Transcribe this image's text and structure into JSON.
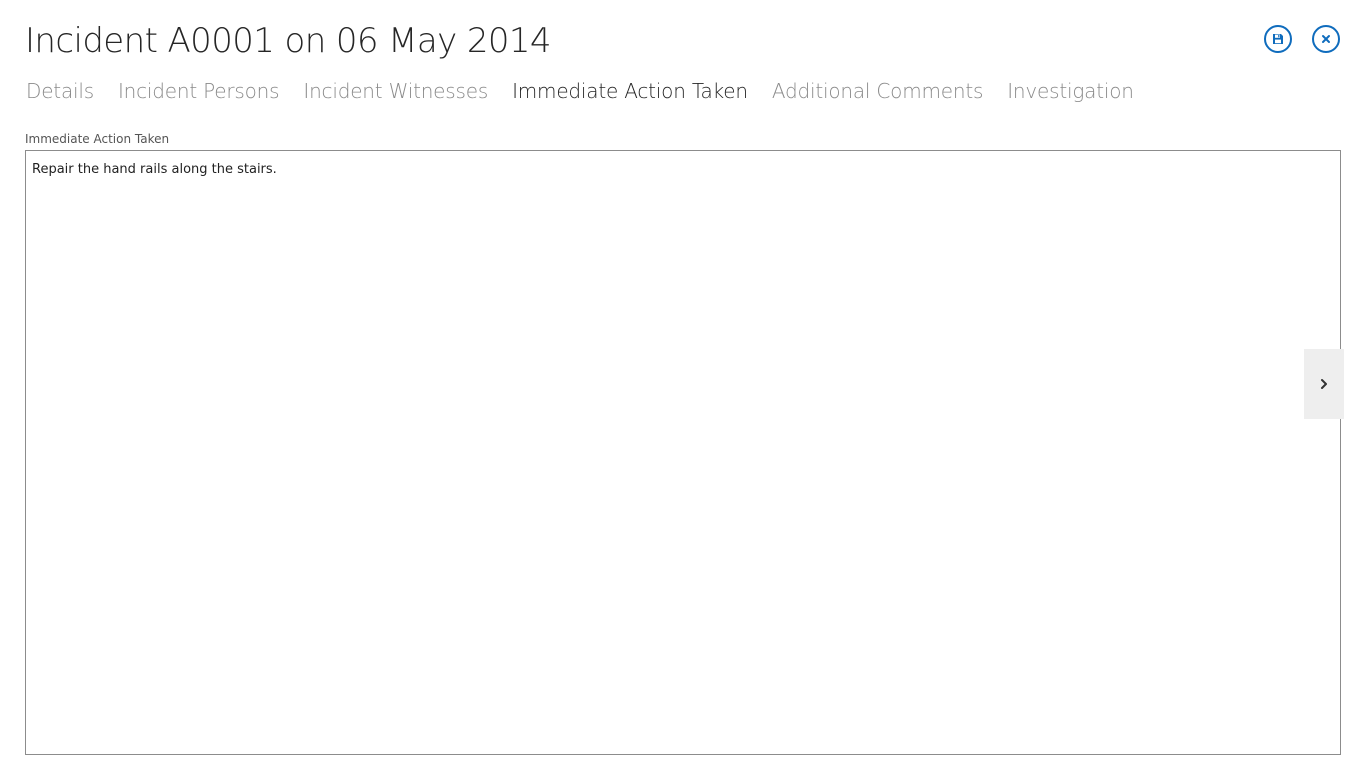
{
  "header": {
    "title": "Incident A0001 on 06 May 2014",
    "save_icon": "save-icon",
    "close_icon": "close-icon",
    "accent_color": "#0f6cbd"
  },
  "tabs": [
    {
      "label": "Details",
      "active": false
    },
    {
      "label": "Incident Persons",
      "active": false
    },
    {
      "label": "Incident Witnesses",
      "active": false
    },
    {
      "label": "Immediate Action Taken",
      "active": true
    },
    {
      "label": "Additional Comments",
      "active": false
    },
    {
      "label": "Investigation",
      "active": false
    }
  ],
  "form": {
    "field_label": "Immediate Action Taken",
    "field_value": "Repair the hand rails along the stairs."
  },
  "side_panel": {
    "toggle_icon": "chevron-right-icon"
  }
}
